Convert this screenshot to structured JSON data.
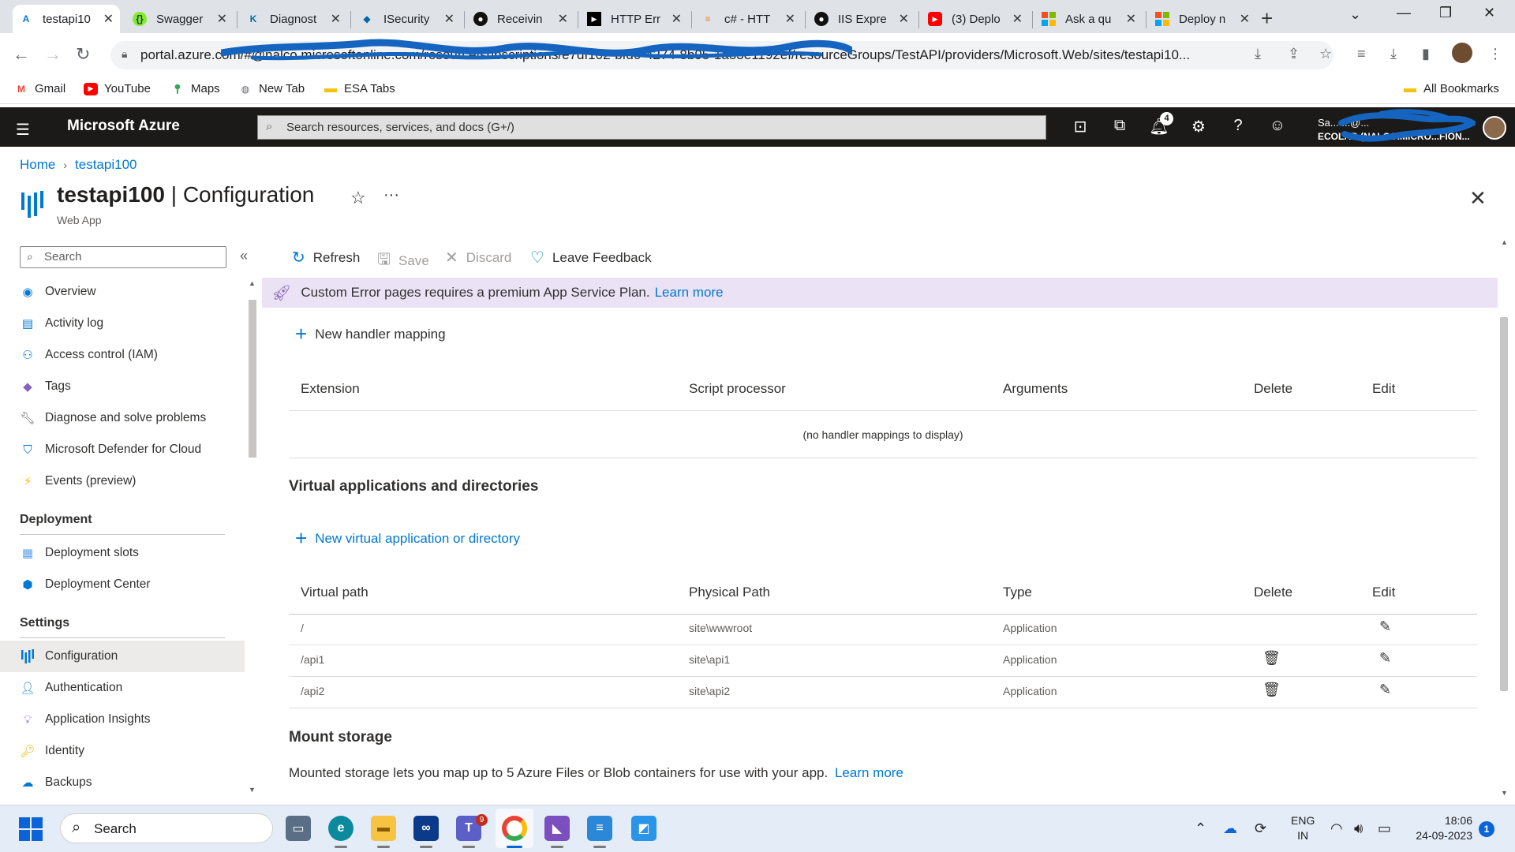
{
  "browser": {
    "tabs": [
      {
        "title": "testapi10",
        "active": true
      },
      {
        "title": "Swagger"
      },
      {
        "title": "Diagnost"
      },
      {
        "title": "ISecurity"
      },
      {
        "title": "Receivin"
      },
      {
        "title": "HTTP Err"
      },
      {
        "title": "c# - HTT"
      },
      {
        "title": "IIS Expre"
      },
      {
        "title": "(3) Deplo"
      },
      {
        "title": "Ask a qu"
      },
      {
        "title": "Deploy n"
      }
    ],
    "url": "portal.azure.com/#@nalco.microsoftonline.com/resource/subscriptions/e7df102-bfd0-4274-8b95-1a53e1192ef/resourceGroups/TestAPI/providers/Microsoft.Web/sites/testapi10...",
    "bookmarks": [
      "Gmail",
      "YouTube",
      "Maps",
      "New Tab",
      "ESA Tabs"
    ],
    "all_bookmarks": "All Bookmarks"
  },
  "portal": {
    "brand": "Microsoft Azure",
    "search_placeholder": "Search resources, services, and docs (G+/)",
    "notification_count": "4",
    "account_line1": "Sa... ...@...",
    "account_line2": "ECOLAB (NALCO.MICRO...FION..."
  },
  "breadcrumb": {
    "home": "Home",
    "current": "testapi100"
  },
  "header": {
    "resource": "testapi100",
    "separator": "|",
    "page": "Configuration",
    "subtitle": "Web App"
  },
  "sidebar": {
    "search_placeholder": "Search",
    "items": [
      {
        "label": "Overview"
      },
      {
        "label": "Activity log"
      },
      {
        "label": "Access control (IAM)"
      },
      {
        "label": "Tags"
      },
      {
        "label": "Diagnose and solve problems"
      },
      {
        "label": "Microsoft Defender for Cloud"
      },
      {
        "label": "Events (preview)"
      }
    ],
    "sections": [
      {
        "title": "Deployment",
        "items": [
          {
            "label": "Deployment slots"
          },
          {
            "label": "Deployment Center"
          }
        ]
      },
      {
        "title": "Settings",
        "items": [
          {
            "label": "Configuration",
            "active": true
          },
          {
            "label": "Authentication"
          },
          {
            "label": "Application Insights"
          },
          {
            "label": "Identity"
          },
          {
            "label": "Backups"
          }
        ]
      }
    ]
  },
  "toolbar": {
    "refresh": "Refresh",
    "save": "Save",
    "discard": "Discard",
    "feedback": "Leave Feedback"
  },
  "banner": {
    "text": "Custom Error pages requires a premium App Service Plan.",
    "link": "Learn more"
  },
  "handlers": {
    "add_label": "New handler mapping",
    "columns": [
      "Extension",
      "Script processor",
      "Arguments",
      "Delete",
      "Edit"
    ],
    "empty": "(no handler mappings to display)"
  },
  "virtual_apps": {
    "title": "Virtual applications and directories",
    "add_label": "New virtual application or directory",
    "columns": [
      "Virtual path",
      "Physical Path",
      "Type",
      "Delete",
      "Edit"
    ],
    "rows": [
      {
        "virtual_path": "/",
        "physical_path": "site\\wwwroot",
        "type": "Application",
        "deletable": false
      },
      {
        "virtual_path": "/api1",
        "physical_path": "site\\api1",
        "type": "Application",
        "deletable": true
      },
      {
        "virtual_path": "/api2",
        "physical_path": "site\\api2",
        "type": "Application",
        "deletable": true
      }
    ]
  },
  "mount_storage": {
    "title": "Mount storage",
    "text": "Mounted storage lets you map up to 5 Azure Files or Blob containers for use with your app.",
    "link": "Learn more"
  },
  "taskbar": {
    "search_placeholder": "Search",
    "teams_badge": "9",
    "lang_line1": "ENG",
    "lang_line2": "IN",
    "time": "18:06",
    "date": "24-09-2023",
    "notifications": "1"
  },
  "colors": {
    "accent": "#0078d4",
    "azure_bar": "#1b1a19",
    "banner_bg": "#ebe3f5",
    "nav_active": "#edebe9"
  }
}
